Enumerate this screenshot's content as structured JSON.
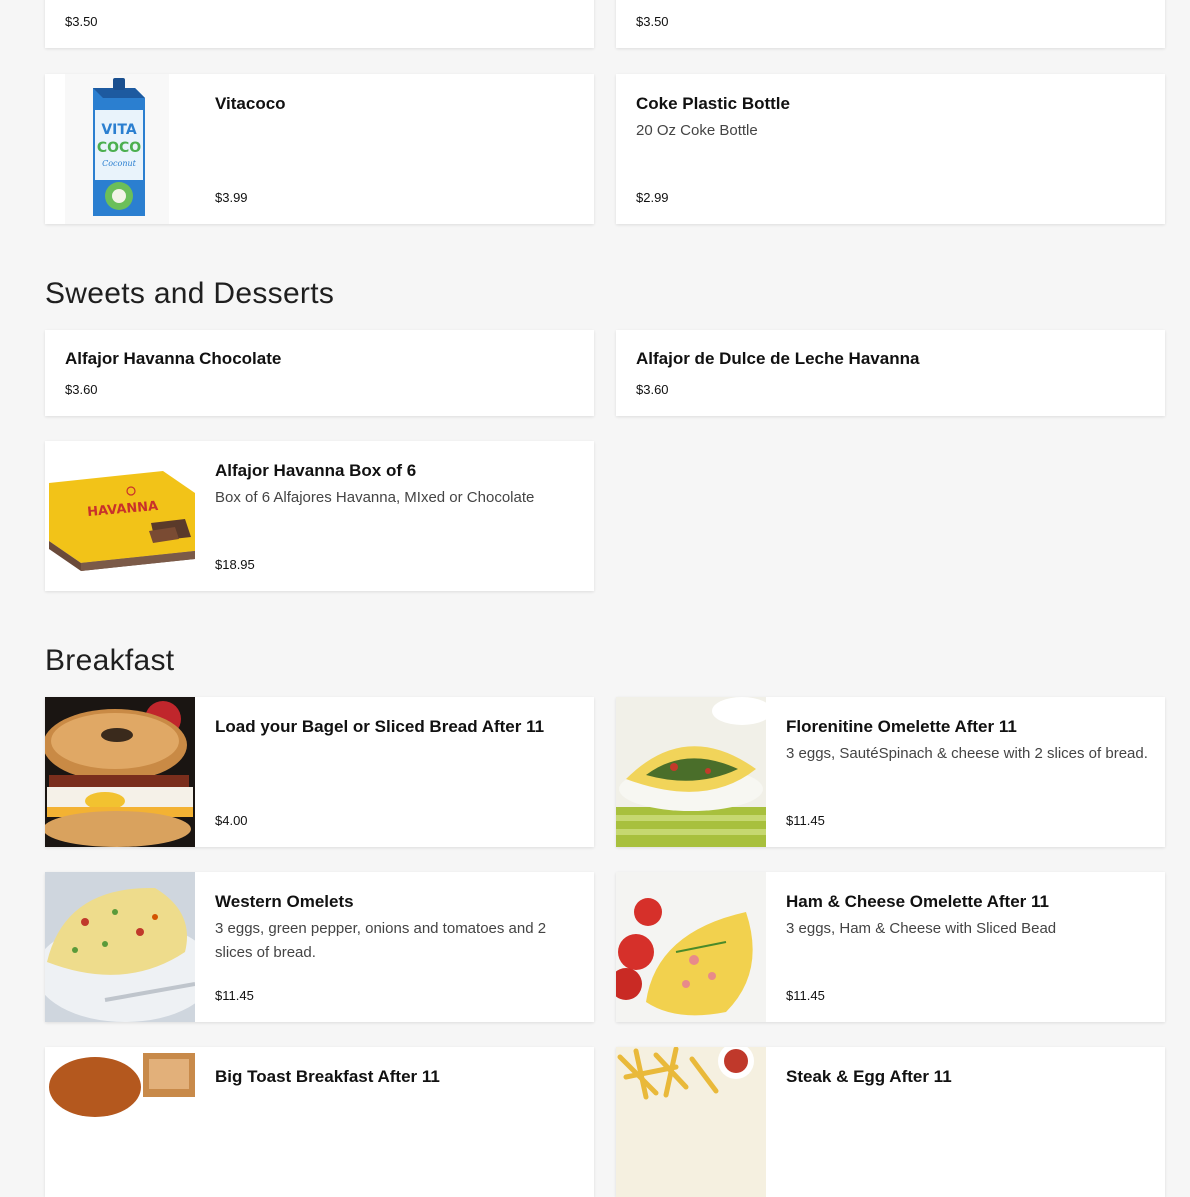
{
  "top_cards": [
    {
      "price": "$3.50"
    },
    {
      "price": "$3.50"
    }
  ],
  "drinks": [
    {
      "name": "Vitacoco",
      "description": "",
      "price": "$3.99",
      "image": "vita-coco-carton"
    },
    {
      "name": "Coke Plastic Bottle",
      "description": "20 Oz Coke Bottle",
      "price": "$2.99"
    }
  ],
  "sections": {
    "sweets": {
      "title": "Sweets and Desserts",
      "items": [
        {
          "name": "Alfajor Havanna Chocolate",
          "price": "$3.60"
        },
        {
          "name": "Alfajor de Dulce de Leche Havanna",
          "price": "$3.60"
        },
        {
          "name": "Alfajor Havanna Box of 6",
          "description": "Box of 6 Alfajores Havanna, MIxed or Chocolate",
          "price": "$18.95",
          "image": "havanna-box"
        }
      ]
    },
    "breakfast": {
      "title": "Breakfast",
      "items": [
        {
          "name": "Load your Bagel or Sliced Bread After 11",
          "description": "",
          "price": "$4.00",
          "image": "bagel-sandwich"
        },
        {
          "name": "Florenitine Omelette After 11",
          "description": "3 eggs, SautéSpinach & cheese with 2 slices of bread.",
          "price": "$11.45",
          "image": "spinach-omelette"
        },
        {
          "name": "Western Omelets",
          "description": "3 eggs, green pepper, onions and tomatoes and 2 slices of bread.",
          "price": "$11.45",
          "image": "western-omelette"
        },
        {
          "name": "Ham & Cheese Omelette After 11",
          "description": "3 eggs, Ham & Cheese with Sliced Bead",
          "price": "$11.45",
          "image": "ham-cheese-omelette"
        },
        {
          "name": "Big Toast Breakfast After 11",
          "image": "toast-breakfast"
        },
        {
          "name": "Steak & Egg After 11",
          "image": "fries-plate"
        }
      ]
    }
  },
  "colors": {
    "background": "#f6f6f6",
    "card": "#ffffff",
    "text": "#111111",
    "description": "#444444"
  }
}
